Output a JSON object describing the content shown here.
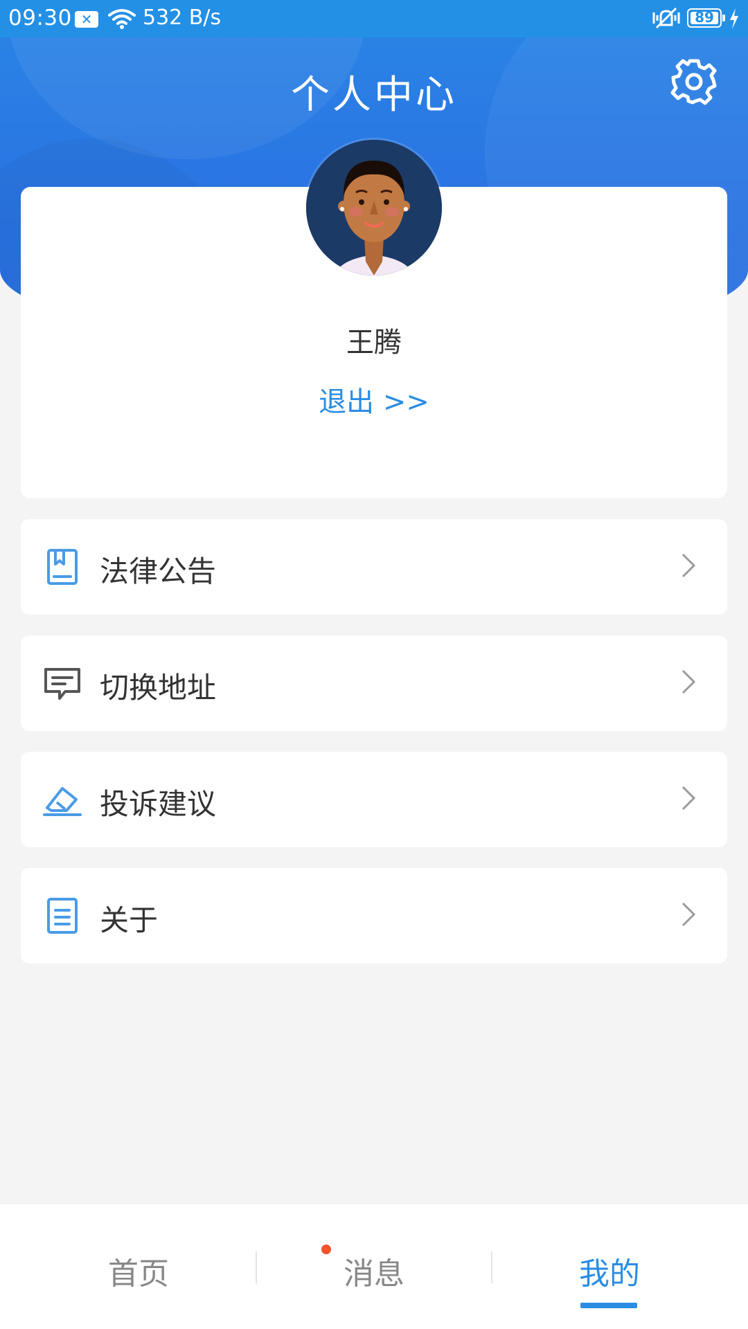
{
  "status_bar": {
    "time": "09:30",
    "network_speed": "532 B/s",
    "battery": "89",
    "icons": [
      "notification-x-icon",
      "wifi-icon",
      "vibrate-mute-icon",
      "battery-icon",
      "charging-bolt-icon"
    ]
  },
  "header": {
    "title": "个人中心",
    "settings_icon": "gear-icon"
  },
  "profile": {
    "name": "王腾",
    "logout": "退出 >>",
    "avatar_icon": "avatar-illustration"
  },
  "menu": {
    "items": [
      {
        "label": "法律公告",
        "icon": "bookmark-document-icon"
      },
      {
        "label": "切换地址",
        "icon": "message-box-icon"
      },
      {
        "label": "投诉建议",
        "icon": "eraser-icon"
      },
      {
        "label": "关于",
        "icon": "document-icon"
      }
    ],
    "arrow_icon": "chevron-right-icon"
  },
  "bottom_nav": {
    "tabs": [
      {
        "label": "首页",
        "active": false
      },
      {
        "label": "消息",
        "active": false,
        "badge": true
      },
      {
        "label": "我的",
        "active": true
      }
    ]
  },
  "colors": {
    "primary": "#2a8de3",
    "header_blue": "#2a7be4",
    "status_bar": "#2390e6",
    "badge": "#f4522c",
    "background": "#f4f4f4"
  }
}
